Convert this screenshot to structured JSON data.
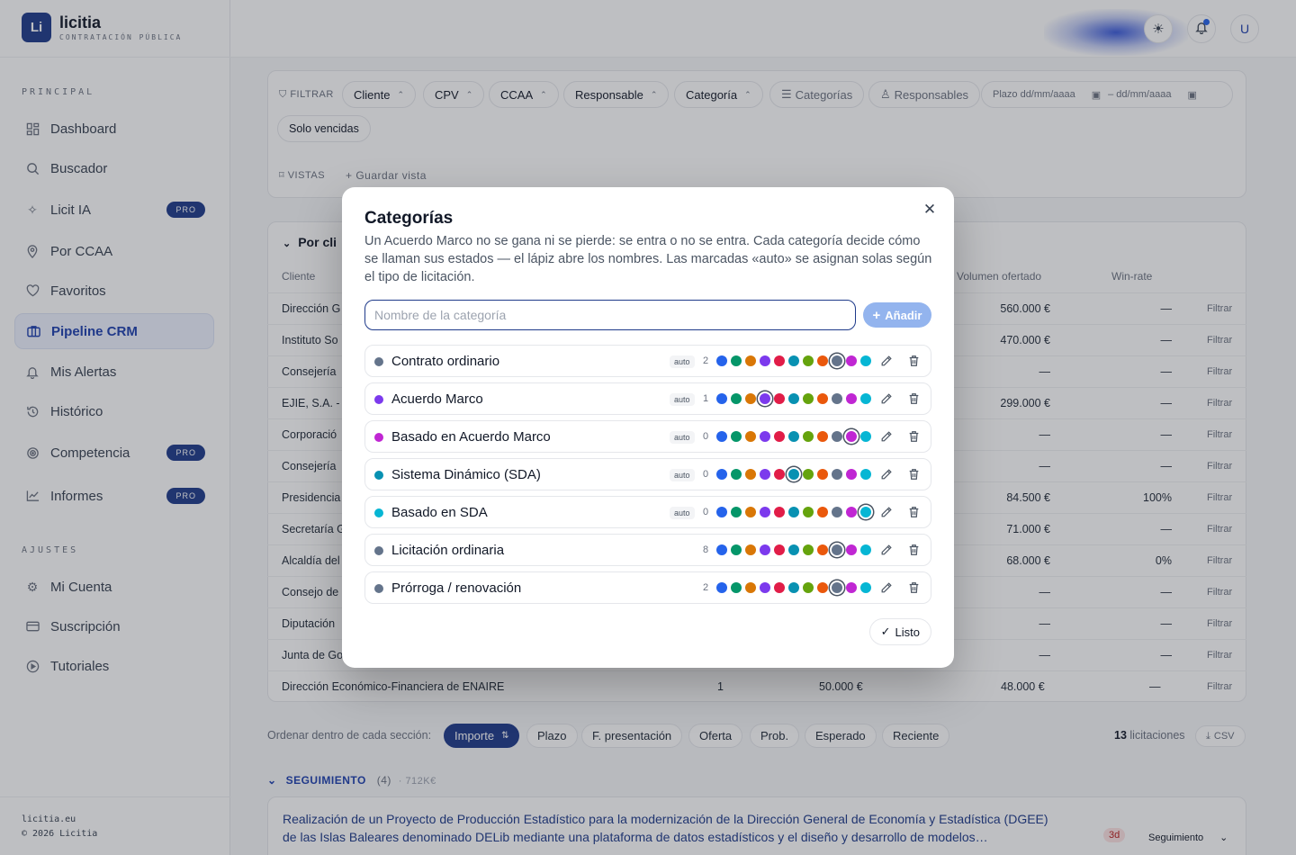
{
  "brand": {
    "name": "licitia",
    "subtitle": "CONTRATACIÓN PÚBLICA",
    "logo_text": "Li"
  },
  "sidebar": {
    "principal_label": "PRINCIPAL",
    "items": [
      {
        "label": "Dashboard",
        "icon": "dashboard-icon"
      },
      {
        "label": "Buscador",
        "icon": "search-icon"
      },
      {
        "label": "Licit IA",
        "icon": "sparkle-icon",
        "badge": "PRO"
      },
      {
        "label": "Por CCAA",
        "icon": "map-pin-icon"
      },
      {
        "label": "Favoritos",
        "icon": "heart-icon"
      },
      {
        "label": "Pipeline CRM",
        "icon": "pipeline-icon"
      },
      {
        "label": "Mis Alertas",
        "icon": "bell-icon"
      },
      {
        "label": "Histórico",
        "icon": "history-icon"
      },
      {
        "label": "Competencia",
        "icon": "target-icon",
        "badge": "PRO"
      },
      {
        "label": "Informes",
        "icon": "chart-icon",
        "badge": "PRO"
      }
    ],
    "ajustes_label": "AJUSTES",
    "settings": [
      {
        "label": "Mi Cuenta",
        "icon": "gear-icon"
      },
      {
        "label": "Suscripción",
        "icon": "card-icon"
      },
      {
        "label": "Tutoriales",
        "icon": "play-icon"
      }
    ],
    "footer_site": "licitia.eu",
    "footer_copy": "© 2026 Licitia"
  },
  "topbar": {
    "avatar_letter": "U"
  },
  "filters": {
    "filtrar": "FILTRAR",
    "chips": [
      "Cliente",
      "CPV",
      "CCAA",
      "Responsable",
      "Categoría"
    ],
    "categorias_btn": "Categorías",
    "responsables_btn": "Responsables",
    "plazo_from": "Plazo dd/mm/aaaa",
    "plazo_to": "– dd/mm/aaaa",
    "solo_vencidas": "Solo vencidas",
    "vistas": "VISTAS",
    "guardar_vista": "Guardar vista"
  },
  "table": {
    "group_title": "Por cli",
    "headers": {
      "cliente": "Cliente",
      "volumen": "Volumen ofertado",
      "winrate": "Win-rate"
    },
    "rows": [
      {
        "cliente": "Dirección G",
        "volumen": "560.000 €",
        "winrate": "—",
        "filtrar": "Filtrar"
      },
      {
        "cliente": "Instituto So",
        "volumen": "470.000 €",
        "winrate": "—",
        "filtrar": "Filtrar"
      },
      {
        "cliente": "Consejería",
        "volumen": "—",
        "winrate": "—",
        "filtrar": "Filtrar"
      },
      {
        "cliente": "EJIE, S.A. - S",
        "volumen": "299.000 €",
        "winrate": "—",
        "filtrar": "Filtrar"
      },
      {
        "cliente": "Corporació",
        "volumen": "—",
        "winrate": "—",
        "filtrar": "Filtrar"
      },
      {
        "cliente": "Consejería",
        "volumen": "—",
        "winrate": "—",
        "filtrar": "Filtrar"
      },
      {
        "cliente": "Presidencia",
        "volumen": "84.500 €",
        "winrate": "100%",
        "filtrar": "Filtrar"
      },
      {
        "cliente": "Secretaría G",
        "volumen": "71.000 €",
        "winrate": "—",
        "filtrar": "Filtrar"
      },
      {
        "cliente": "Alcaldía del",
        "volumen": "68.000 €",
        "winrate": "0%",
        "filtrar": "Filtrar"
      },
      {
        "cliente": "Consejo de",
        "volumen": "—",
        "winrate": "—",
        "filtrar": "Filtrar"
      },
      {
        "cliente": "Diputación",
        "volumen": "—",
        "winrate": "—",
        "filtrar": "Filtrar"
      },
      {
        "cliente": "Junta de Go",
        "volumen": "—",
        "winrate": "—",
        "filtrar": "Filtrar"
      }
    ],
    "last_row": {
      "cliente": "Dirección Económico-Financiera de ENAIRE",
      "count": "1",
      "importe": "50.000 €",
      "volumen": "48.000 €",
      "winrate": "—",
      "filtrar": "Filtrar"
    }
  },
  "sort": {
    "label": "Ordenar dentro de cada sección:",
    "options": [
      "Importe",
      "Plazo",
      "F. presentación",
      "Oferta",
      "Prob.",
      "Esperado",
      "Reciente"
    ],
    "active": "Importe",
    "count": "13",
    "count_label": "licitaciones",
    "csv": "CSV"
  },
  "seguimiento": {
    "title": "SEGUIMIENTO",
    "count": "(4)",
    "total": "· 712K€",
    "item_title_1": "Realización de un Proyecto de Producción Estadístico para la modernización de la Dirección General de Economía y Estadística (DGEE)",
    "item_title_2": "de las Islas Baleares denominado DELib mediante una plataforma de datos estadísticos y el diseño y desarrollo de modelos…",
    "item_days": "3d",
    "item_status": "Seguimiento"
  },
  "modal": {
    "title": "Categorías",
    "description": "Un Acuerdo Marco no se gana ni se pierde: se entra o no se entra. Cada categoría decide cómo se llaman sus estados — el lápiz abre los nombres. Las marcadas «auto» se asignan solas según el tipo de licitación.",
    "input_placeholder": "Nombre de la categoría",
    "input_value": "",
    "add_label": "Añadir",
    "done_label": "Listo",
    "palette": [
      "#2563eb",
      "#059669",
      "#d97706",
      "#7c3aed",
      "#e11d48",
      "#0891b2",
      "#65a30d",
      "#ea580c",
      "#64748b",
      "#c026d3",
      "#06b6d4"
    ],
    "categories": [
      {
        "name": "Contrato ordinario",
        "color": "#64748b",
        "auto": "auto",
        "count": "2",
        "selected": 8
      },
      {
        "name": "Acuerdo Marco",
        "color": "#7c3aed",
        "auto": "auto",
        "count": "1",
        "selected": 3
      },
      {
        "name": "Basado en Acuerdo Marco",
        "color": "#c026d3",
        "auto": "auto",
        "count": "0",
        "selected": 9
      },
      {
        "name": "Sistema Dinámico (SDA)",
        "color": "#0891b2",
        "auto": "auto",
        "count": "0",
        "selected": 5
      },
      {
        "name": "Basado en SDA",
        "color": "#06b6d4",
        "auto": "auto",
        "count": "0",
        "selected": 10
      },
      {
        "name": "Licitación ordinaria",
        "color": "#64748b",
        "auto": "",
        "count": "8",
        "selected": 8
      },
      {
        "name": "Prórroga / renovación",
        "color": "#64748b",
        "auto": "",
        "count": "2",
        "selected": 8
      }
    ]
  }
}
